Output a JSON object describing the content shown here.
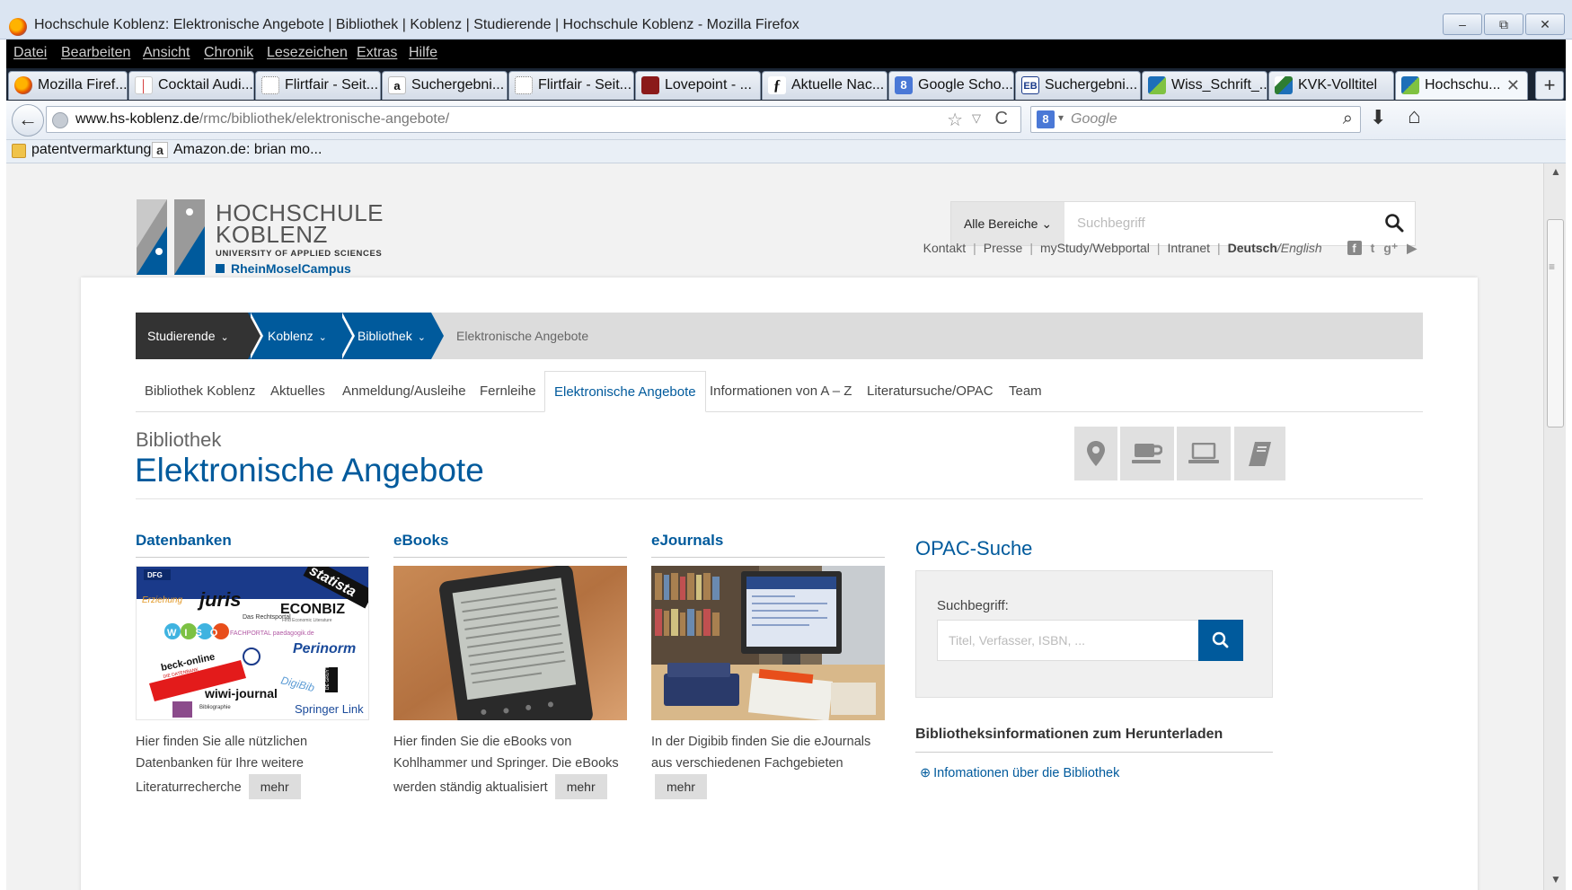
{
  "window": {
    "title": "Hochschule Koblenz: Elektronische Angebote | Bibliothek | Koblenz | Studierende | Hochschule Koblenz - Mozilla Firefox",
    "controls": [
      "–",
      "⧉",
      "✕"
    ]
  },
  "menubar": [
    "Datei",
    "Bearbeiten",
    "Ansicht",
    "Chronik",
    "Lesezeichen",
    "Extras",
    "Hilfe"
  ],
  "tabs": [
    {
      "label": "Mozilla Firef...",
      "icon": "firefox-icon",
      "icon_char": "",
      "icon_color": "#e65100"
    },
    {
      "label": "Cocktail Audi...",
      "icon": "cocktail-icon",
      "icon_char": "│",
      "icon_color": "#d32f2f"
    },
    {
      "label": "Flirtfair - Seit...",
      "icon": "blank-page-icon",
      "icon_char": "",
      "icon_color": "#ffffff"
    },
    {
      "label": "Suchergebni...",
      "icon": "amazon-icon",
      "icon_char": "a",
      "icon_color": "#ffffff"
    },
    {
      "label": "Flirtfair - Seit...",
      "icon": "blank-page-icon",
      "icon_char": "",
      "icon_color": "#ffffff"
    },
    {
      "label": "Lovepoint - ...",
      "icon": "lovepoint-icon",
      "icon_char": "",
      "icon_color": "#8b1a1a"
    },
    {
      "label": "Aktuelle Nac...",
      "icon": "news-icon",
      "icon_char": "ƒ",
      "icon_color": "#ffffff"
    },
    {
      "label": "Google Scho...",
      "icon": "google-scholar-icon",
      "icon_char": "8",
      "icon_color": "#4a78d6"
    },
    {
      "label": "Suchergebni...",
      "icon": "eb-icon",
      "icon_char": "EB",
      "icon_color": "#ffffff"
    },
    {
      "label": "Wiss_Schrift_...",
      "icon": "hs-icon",
      "icon_char": "",
      "icon_color": "#1d6fb8"
    },
    {
      "label": "KVK-Volltitel",
      "icon": "kvk-icon",
      "icon_char": "",
      "icon_color": "#2e7d32"
    },
    {
      "label": "Hochschu...",
      "icon": "hs-icon",
      "icon_char": "",
      "icon_color": "#1d6fb8"
    }
  ],
  "tab_close": "✕",
  "new_tab": "+",
  "navbar": {
    "back": "←",
    "url_domain": "www.hs-koblenz.de",
    "url_path": "/rmc/bibliothek/elektronische-angebote/",
    "star": "☆",
    "dropdown": "▽",
    "reload": "C",
    "search_engine": "8",
    "search_dropdown": "▾",
    "search_placeholder": "Google",
    "search_icon": "⌕",
    "download": "⬇",
    "home": "⌂"
  },
  "bookmarks": {
    "first": "patentvermarktung",
    "amazon_glyph": "a",
    "second": "Amazon.de: brian mo..."
  },
  "scrollbar": {
    "up": "▲",
    "down": "▼",
    "grip": "≡"
  },
  "logo": {
    "line1": "HOCHSCHULE",
    "line2": "KOBLENZ",
    "line3": "UNIVERSITY OF APPLIED SCIENCES",
    "line4": "RheinMoselCampus"
  },
  "site_search": {
    "area": "Alle Bereiche ⌄",
    "placeholder": "Suchbegriff"
  },
  "toplinks": {
    "items": [
      "Kontakt",
      "Presse",
      "myStudy/Webportal",
      "Intranet"
    ],
    "lang_de": "Deutsch",
    "lang_sep": " / ",
    "lang_en": "English",
    "social": [
      "f",
      "t",
      "g⁺",
      "▶"
    ]
  },
  "breadcrumb": {
    "items": [
      "Studierende",
      "Koblenz",
      "Bibliothek"
    ],
    "current": "Elektronische Angebote",
    "chevron": "⌄"
  },
  "subnav": [
    "Bibliothek Koblenz",
    "Aktuelles",
    "Anmeldung/Ausleihe",
    "Fernleihe",
    "Elektronische Angebote",
    "Informationen von A – Z",
    "Literatursuche/OPAC",
    "Team"
  ],
  "heading": {
    "pre": "Bibliothek",
    "title": "Elektronische Angebote"
  },
  "info_icons": [
    "location-icon",
    "coffee-icon",
    "laptop-icon",
    "book-icon"
  ],
  "columns": [
    {
      "title": "Datenbanken",
      "text": "Hier finden Sie alle nützlichen Datenbanken für Ihre weitere Literaturrecherche",
      "more": "mehr"
    },
    {
      "title": "eBooks",
      "text": "Hier finden Sie die eBooks von Kohlhammer und Springer. Die eBooks werden ständig aktualisiert",
      "more": "mehr"
    },
    {
      "title": "eJournals",
      "text": "In der Digibib finden Sie die eJournals aus verschiedenen Fachgebieten",
      "more": "mehr"
    }
  ],
  "db_collage_words": {
    "dfg": "DFG",
    "statista": "statista",
    "juris": "juris",
    "juris_sub": "Das Rechtsportal",
    "econbiz": "ECONBIZ",
    "econbiz_sub": "Find Economic Literature",
    "erziehung": "Erziehung",
    "wiso": "WISO",
    "paedagogik": "FACHPORTAL paedagogik.de",
    "perinorm": "Perinorm",
    "beck": "beck-online",
    "beck_sub": "DIE DATENBANK",
    "digibib": "DigiBib",
    "gruyter": "DE GRUYTER",
    "wiwi": "wiwi-journal",
    "springer": "Springer Link",
    "biblio": "Bibliographie"
  },
  "opac": {
    "title": "OPAC-Suche",
    "label": "Suchbegriff:",
    "placeholder": "Titel, Verfasser, ISBN, ..."
  },
  "downloads": {
    "title": "Bibliotheksinformationen zum Herunterladen",
    "link": "Infomationen über die Bibliothek"
  }
}
